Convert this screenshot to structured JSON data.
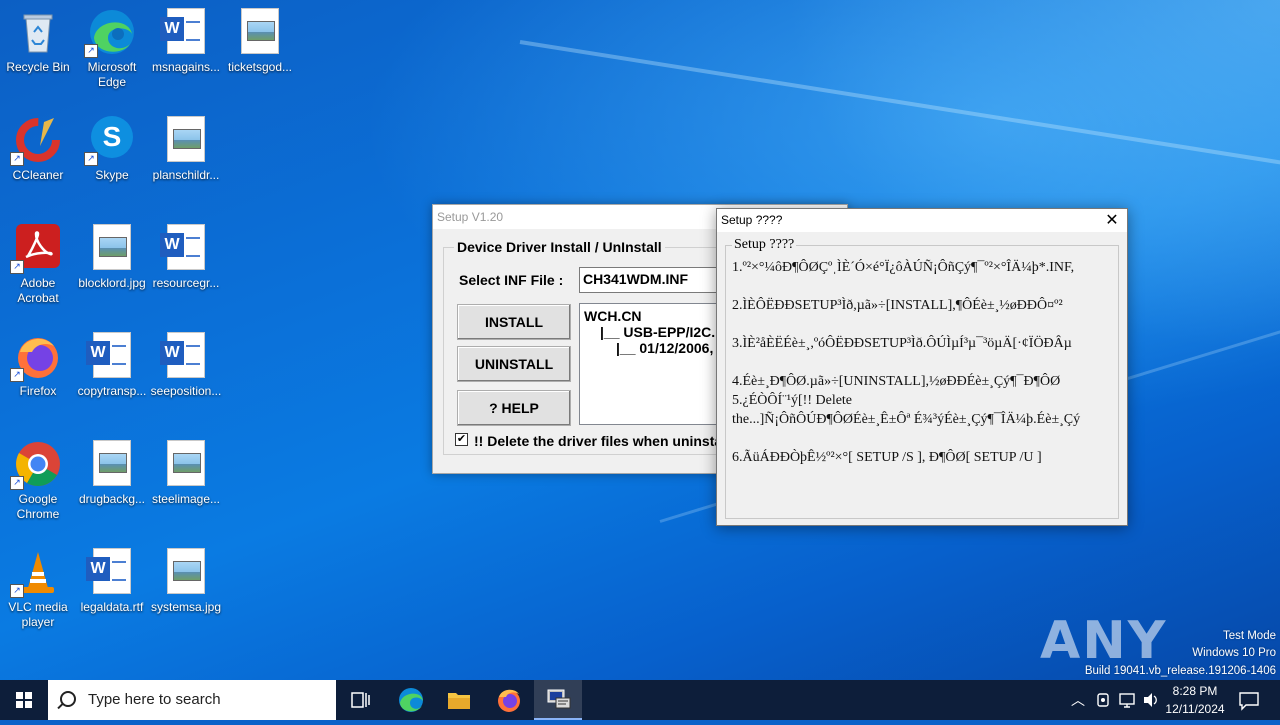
{
  "desktop": {
    "icons": [
      {
        "label": "Recycle Bin"
      },
      {
        "label": "Microsoft Edge"
      },
      {
        "label": "msnagains..."
      },
      {
        "label": "ticketsgod..."
      },
      {
        "label": "CCleaner"
      },
      {
        "label": "Skype"
      },
      {
        "label": "planschildr..."
      },
      {
        "label": "Adobe Acrobat"
      },
      {
        "label": "blocklord.jpg"
      },
      {
        "label": "resourcegr..."
      },
      {
        "label": "Firefox"
      },
      {
        "label": "copytransp..."
      },
      {
        "label": "seeposition..."
      },
      {
        "label": "Google Chrome"
      },
      {
        "label": "drugbackg..."
      },
      {
        "label": "steelimage..."
      },
      {
        "label": "VLC media player"
      },
      {
        "label": "legaldata.rtf"
      },
      {
        "label": "systemsa.jpg"
      }
    ]
  },
  "setup_window": {
    "title": "Setup V1.20",
    "group_title": "Device Driver Install / UnInstall",
    "select_inf_label": "Select INF File :",
    "inf_value": "CH341WDM.INF",
    "install_label": "INSTALL",
    "uninstall_label": "UNINSTALL",
    "help_label": "? HELP",
    "tree": [
      "WCH.CN",
      "|__ USB-EPP/I2C...",
      "|__ 01/12/2006,"
    ],
    "delete_checkbox_label": "!! Delete the driver files when uninsta",
    "delete_checked": true
  },
  "message_window": {
    "title": "Setup ????",
    "group_title": "Setup ????",
    "lines": [
      "1.º²×°¼ôÐ¶ÔØÇºˌÌÈ´Ó×é°Ï¿ôÀÚÑ¡ÔñÇý¶¯º²×°ÎÄ¼þ*.INF,",
      "",
      "2.ÌÈÔËÐÐSETUP³Ìð,µã»÷[INSTALL],¶ÔÉè±¸½øÐÐÔ¤º²",
      "",
      "3.ÌÈ²åÈËÉè±¸,ºóÔËÐÐSETUP³Ìð.ÔÚÌµÍ³µ¯³öµÄ[·¢ÏÖÐÂµ",
      "",
      "4.Éè±¸Ð¶ÔØ.µã»÷[UNINSTALL],½øÐÐÉè±¸Çý¶¯Ð¶ÔØ",
      "5.¿ÉÒÔÍ¨¹ý[!! Delete",
      "the...]Ñ¡ÔñÔÚÐ¶ÔØÉè±¸Ê±Ôª É¾³ýÉè±¸Çý¶¯ÎÄ¼þ.Éè±¸Çý",
      "",
      "6.ÃüÁÐÐÒþÊ½º²×°[ SETUP /S ], Ð¶ÔØ[ SETUP /U ]"
    ]
  },
  "watermark": {
    "brand": "ANY RUN",
    "mode": "Test Mode",
    "os": "Windows 10 Pro",
    "build": "Build 19041.vb_release.191206-1406"
  },
  "taskbar": {
    "search_placeholder": "Type here to search",
    "time": "8:28 PM",
    "date": "12/11/2024"
  }
}
